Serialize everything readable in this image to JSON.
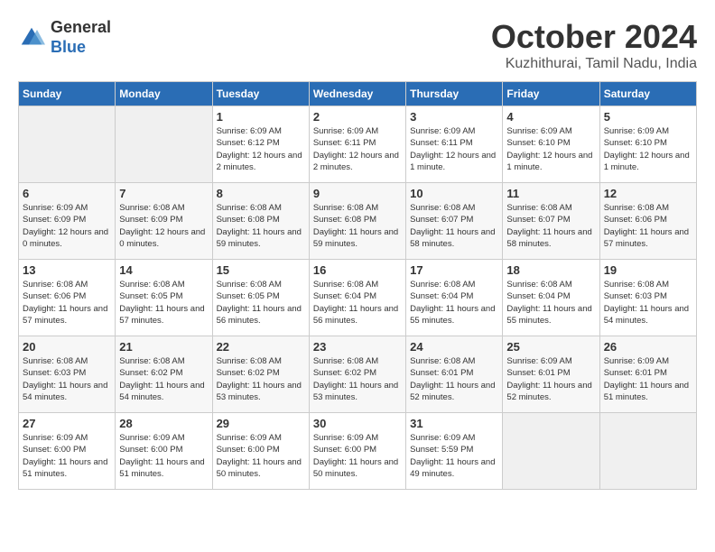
{
  "logo": {
    "general": "General",
    "blue": "Blue"
  },
  "title": "October 2024",
  "location": "Kuzhithurai, Tamil Nadu, India",
  "weekdays": [
    "Sunday",
    "Monday",
    "Tuesday",
    "Wednesday",
    "Thursday",
    "Friday",
    "Saturday"
  ],
  "weeks": [
    [
      {
        "day": "",
        "sunrise": "",
        "sunset": "",
        "daylight": ""
      },
      {
        "day": "",
        "sunrise": "",
        "sunset": "",
        "daylight": ""
      },
      {
        "day": "1",
        "sunrise": "Sunrise: 6:09 AM",
        "sunset": "Sunset: 6:12 PM",
        "daylight": "Daylight: 12 hours and 2 minutes."
      },
      {
        "day": "2",
        "sunrise": "Sunrise: 6:09 AM",
        "sunset": "Sunset: 6:11 PM",
        "daylight": "Daylight: 12 hours and 2 minutes."
      },
      {
        "day": "3",
        "sunrise": "Sunrise: 6:09 AM",
        "sunset": "Sunset: 6:11 PM",
        "daylight": "Daylight: 12 hours and 1 minute."
      },
      {
        "day": "4",
        "sunrise": "Sunrise: 6:09 AM",
        "sunset": "Sunset: 6:10 PM",
        "daylight": "Daylight: 12 hours and 1 minute."
      },
      {
        "day": "5",
        "sunrise": "Sunrise: 6:09 AM",
        "sunset": "Sunset: 6:10 PM",
        "daylight": "Daylight: 12 hours and 1 minute."
      }
    ],
    [
      {
        "day": "6",
        "sunrise": "Sunrise: 6:09 AM",
        "sunset": "Sunset: 6:09 PM",
        "daylight": "Daylight: 12 hours and 0 minutes."
      },
      {
        "day": "7",
        "sunrise": "Sunrise: 6:08 AM",
        "sunset": "Sunset: 6:09 PM",
        "daylight": "Daylight: 12 hours and 0 minutes."
      },
      {
        "day": "8",
        "sunrise": "Sunrise: 6:08 AM",
        "sunset": "Sunset: 6:08 PM",
        "daylight": "Daylight: 11 hours and 59 minutes."
      },
      {
        "day": "9",
        "sunrise": "Sunrise: 6:08 AM",
        "sunset": "Sunset: 6:08 PM",
        "daylight": "Daylight: 11 hours and 59 minutes."
      },
      {
        "day": "10",
        "sunrise": "Sunrise: 6:08 AM",
        "sunset": "Sunset: 6:07 PM",
        "daylight": "Daylight: 11 hours and 58 minutes."
      },
      {
        "day": "11",
        "sunrise": "Sunrise: 6:08 AM",
        "sunset": "Sunset: 6:07 PM",
        "daylight": "Daylight: 11 hours and 58 minutes."
      },
      {
        "day": "12",
        "sunrise": "Sunrise: 6:08 AM",
        "sunset": "Sunset: 6:06 PM",
        "daylight": "Daylight: 11 hours and 57 minutes."
      }
    ],
    [
      {
        "day": "13",
        "sunrise": "Sunrise: 6:08 AM",
        "sunset": "Sunset: 6:06 PM",
        "daylight": "Daylight: 11 hours and 57 minutes."
      },
      {
        "day": "14",
        "sunrise": "Sunrise: 6:08 AM",
        "sunset": "Sunset: 6:05 PM",
        "daylight": "Daylight: 11 hours and 57 minutes."
      },
      {
        "day": "15",
        "sunrise": "Sunrise: 6:08 AM",
        "sunset": "Sunset: 6:05 PM",
        "daylight": "Daylight: 11 hours and 56 minutes."
      },
      {
        "day": "16",
        "sunrise": "Sunrise: 6:08 AM",
        "sunset": "Sunset: 6:04 PM",
        "daylight": "Daylight: 11 hours and 56 minutes."
      },
      {
        "day": "17",
        "sunrise": "Sunrise: 6:08 AM",
        "sunset": "Sunset: 6:04 PM",
        "daylight": "Daylight: 11 hours and 55 minutes."
      },
      {
        "day": "18",
        "sunrise": "Sunrise: 6:08 AM",
        "sunset": "Sunset: 6:04 PM",
        "daylight": "Daylight: 11 hours and 55 minutes."
      },
      {
        "day": "19",
        "sunrise": "Sunrise: 6:08 AM",
        "sunset": "Sunset: 6:03 PM",
        "daylight": "Daylight: 11 hours and 54 minutes."
      }
    ],
    [
      {
        "day": "20",
        "sunrise": "Sunrise: 6:08 AM",
        "sunset": "Sunset: 6:03 PM",
        "daylight": "Daylight: 11 hours and 54 minutes."
      },
      {
        "day": "21",
        "sunrise": "Sunrise: 6:08 AM",
        "sunset": "Sunset: 6:02 PM",
        "daylight": "Daylight: 11 hours and 54 minutes."
      },
      {
        "day": "22",
        "sunrise": "Sunrise: 6:08 AM",
        "sunset": "Sunset: 6:02 PM",
        "daylight": "Daylight: 11 hours and 53 minutes."
      },
      {
        "day": "23",
        "sunrise": "Sunrise: 6:08 AM",
        "sunset": "Sunset: 6:02 PM",
        "daylight": "Daylight: 11 hours and 53 minutes."
      },
      {
        "day": "24",
        "sunrise": "Sunrise: 6:08 AM",
        "sunset": "Sunset: 6:01 PM",
        "daylight": "Daylight: 11 hours and 52 minutes."
      },
      {
        "day": "25",
        "sunrise": "Sunrise: 6:09 AM",
        "sunset": "Sunset: 6:01 PM",
        "daylight": "Daylight: 11 hours and 52 minutes."
      },
      {
        "day": "26",
        "sunrise": "Sunrise: 6:09 AM",
        "sunset": "Sunset: 6:01 PM",
        "daylight": "Daylight: 11 hours and 51 minutes."
      }
    ],
    [
      {
        "day": "27",
        "sunrise": "Sunrise: 6:09 AM",
        "sunset": "Sunset: 6:00 PM",
        "daylight": "Daylight: 11 hours and 51 minutes."
      },
      {
        "day": "28",
        "sunrise": "Sunrise: 6:09 AM",
        "sunset": "Sunset: 6:00 PM",
        "daylight": "Daylight: 11 hours and 51 minutes."
      },
      {
        "day": "29",
        "sunrise": "Sunrise: 6:09 AM",
        "sunset": "Sunset: 6:00 PM",
        "daylight": "Daylight: 11 hours and 50 minutes."
      },
      {
        "day": "30",
        "sunrise": "Sunrise: 6:09 AM",
        "sunset": "Sunset: 6:00 PM",
        "daylight": "Daylight: 11 hours and 50 minutes."
      },
      {
        "day": "31",
        "sunrise": "Sunrise: 6:09 AM",
        "sunset": "Sunset: 5:59 PM",
        "daylight": "Daylight: 11 hours and 49 minutes."
      },
      {
        "day": "",
        "sunrise": "",
        "sunset": "",
        "daylight": ""
      },
      {
        "day": "",
        "sunrise": "",
        "sunset": "",
        "daylight": ""
      }
    ]
  ]
}
